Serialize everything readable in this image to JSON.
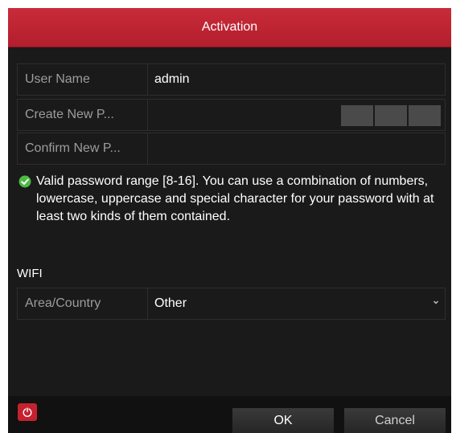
{
  "dialog": {
    "title": "Activation"
  },
  "fields": {
    "username_label": "User Name",
    "username_value": "admin",
    "new_password_label": "Create New P...",
    "confirm_password_label": "Confirm New P..."
  },
  "hint": {
    "text": "Valid password range [8-16]. You can use a combination of numbers, lowercase, uppercase and special character for your password with at least two kinds of them contained."
  },
  "wifi": {
    "section_label": "WIFI",
    "area_label": "Area/Country",
    "area_value": "Other"
  },
  "footer": {
    "ok_label": "OK",
    "cancel_label": "Cancel"
  },
  "colors": {
    "title_bar": "#c92b3a",
    "background": "#1a1a1a",
    "check_icon": "#4cb944",
    "power_button": "#c4222e"
  },
  "icons": {
    "hint": "check-circle-icon",
    "select": "chevron-down-icon",
    "footer": "power-icon"
  }
}
